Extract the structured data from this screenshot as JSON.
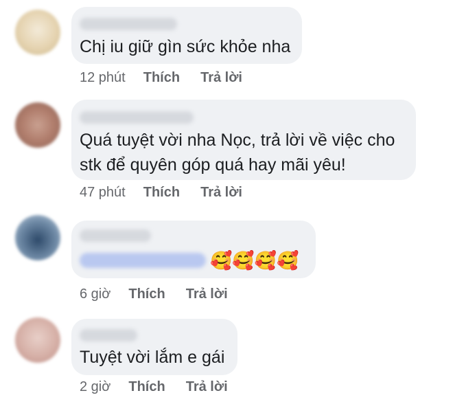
{
  "comments": [
    {
      "text": "Chị iu giữ gìn sức khỏe nha",
      "time": "12 phút",
      "like": "Thích",
      "reply": "Trả lời"
    },
    {
      "text_line1": "Quá tuyệt vời nha Nọc, trả lời về việc cho",
      "text_line2": "stk để quyên góp quá hay mãi yêu!",
      "time": "47 phút",
      "like": "Thích",
      "reply": "Trả lời"
    },
    {
      "emoji": "🥰🥰🥰🥰",
      "time": "6 giờ",
      "like": "Thích",
      "reply": "Trả lời"
    },
    {
      "text": "Tuyệt vời lắm e gái",
      "time": "2 giờ",
      "like": "Thích",
      "reply": "Trả lời"
    }
  ]
}
